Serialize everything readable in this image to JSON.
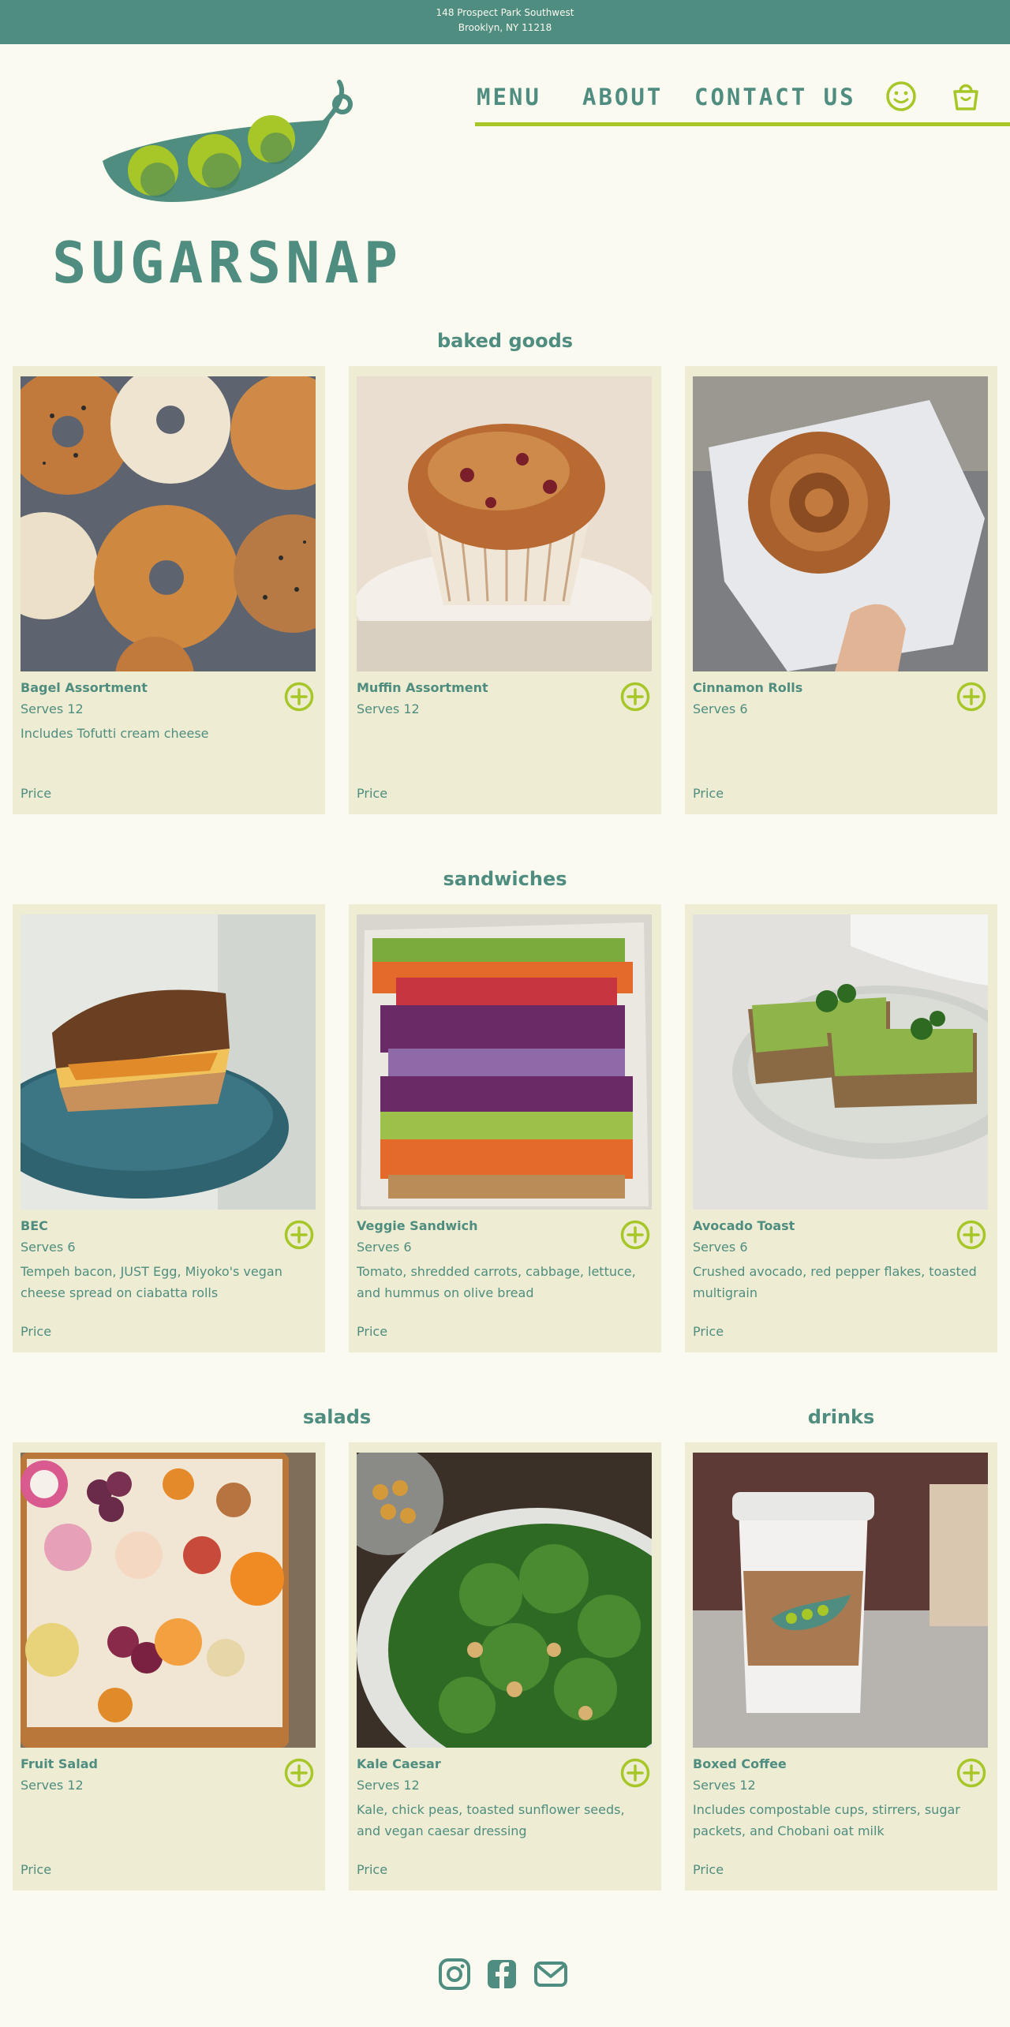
{
  "address": {
    "line1": "148 Prospect Park Southwest",
    "line2": "Brooklyn, NY 11218"
  },
  "brand": {
    "name": "SUGARSNAP",
    "colors": {
      "primary": "#4e8d7f",
      "accent": "#a7c628",
      "background": "#fbfaf0",
      "card": "#eeedd3"
    }
  },
  "nav": {
    "items": [
      "MENU",
      "ABOUT",
      "CONTACT US"
    ],
    "icons": [
      "smiley-icon",
      "shopping-bag-icon"
    ]
  },
  "sections": {
    "baked_goods": {
      "title": "baked goods",
      "items": [
        {
          "name": "Bagel Assortment",
          "serves": "Serves 12",
          "desc": "Includes Tofutti cream cheese",
          "price": "Price"
        },
        {
          "name": "Muffin Assortment",
          "serves": "Serves 12",
          "desc": "",
          "price": "Price"
        },
        {
          "name": "Cinnamon Rolls",
          "serves": "Serves 6",
          "desc": "",
          "price": "Price"
        }
      ]
    },
    "sandwiches": {
      "title": "sandwiches",
      "items": [
        {
          "name": "BEC",
          "serves": "Serves 6",
          "desc": "Tempeh bacon, JUST Egg, Miyoko's vegan cheese spread on ciabatta rolls",
          "price": "Price"
        },
        {
          "name": "Veggie Sandwich",
          "serves": "Serves 6",
          "desc": "Tomato, shredded carrots, cabbage, lettuce, and hummus on olive bread",
          "price": "Price"
        },
        {
          "name": "Avocado Toast",
          "serves": "Serves 6",
          "desc": "Crushed avocado, red pepper flakes, toasted multigrain",
          "price": "Price"
        }
      ]
    },
    "salads": {
      "title": "salads",
      "items": [
        {
          "name": "Fruit Salad",
          "serves": "Serves 12",
          "desc": "",
          "price": "Price"
        },
        {
          "name": "Kale Caesar",
          "serves": "Serves 12",
          "desc": "Kale, chick peas, toasted sunflower seeds, and vegan caesar dressing",
          "price": "Price"
        }
      ]
    },
    "drinks": {
      "title": "drinks",
      "items": [
        {
          "name": "Boxed Coffee",
          "serves": "Serves 12",
          "desc": "Includes compostable cups, stirrers, sugar packets, and Chobani oat milk",
          "price": "Price"
        }
      ]
    }
  },
  "footer": {
    "icons": [
      "instagram-icon",
      "facebook-icon",
      "mail-icon"
    ]
  }
}
